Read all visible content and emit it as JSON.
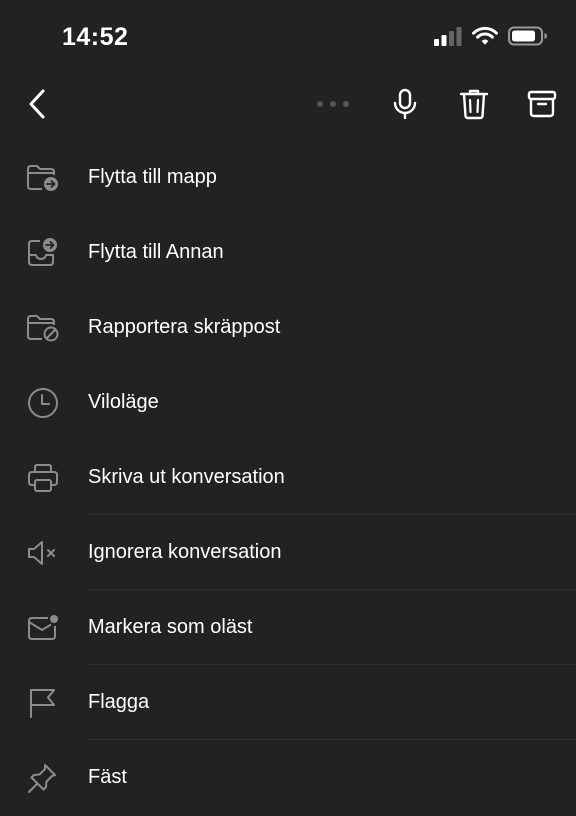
{
  "status_bar": {
    "time": "14:52",
    "icons": [
      "cellular-signal-icon",
      "wifi-icon",
      "battery-icon"
    ]
  },
  "toolbar": {
    "icons": [
      "back-chevron-icon",
      "more-dots-icon",
      "microphone-icon",
      "trash-icon",
      "archive-icon"
    ]
  },
  "menu": {
    "items": [
      {
        "label": "Flytta till mapp",
        "icon": "folder-move-icon"
      },
      {
        "label": "Flytta till Annan",
        "icon": "inbox-move-icon"
      },
      {
        "label": "Rapportera skräppost",
        "icon": "folder-block-icon"
      },
      {
        "label": "Viloläge",
        "icon": "clock-icon"
      },
      {
        "label": "Skriva ut konversation",
        "icon": "printer-icon"
      },
      {
        "label": "Ignorera konversation",
        "icon": "speaker-mute-icon"
      },
      {
        "label": "Markera som oläst",
        "icon": "mail-unread-icon"
      },
      {
        "label": "Flagga",
        "icon": "flag-icon"
      },
      {
        "label": "Fäst",
        "icon": "pin-icon"
      }
    ]
  },
  "colors": {
    "background": "#222222",
    "text": "#ffffff",
    "icon": "#8c8c8c",
    "divider": "#2e2e2e"
  }
}
